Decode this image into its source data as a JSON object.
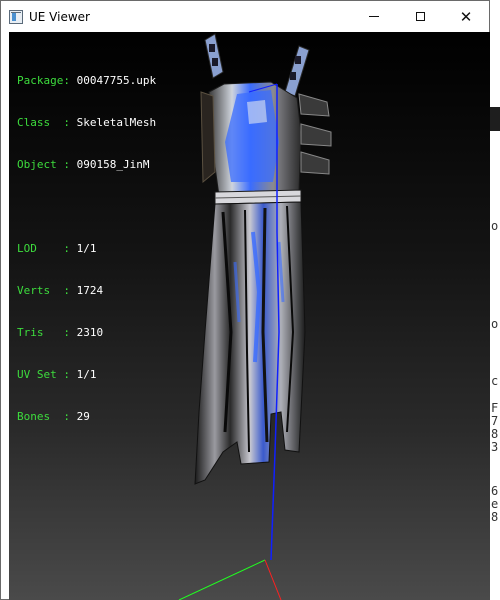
{
  "window": {
    "title": "UE Viewer",
    "buttons": {
      "minimize": "—",
      "maximize": "☐",
      "close": "✕"
    }
  },
  "info": {
    "package_label": "Package:",
    "package": "00047755.upk",
    "class_label": "Class  :",
    "class": "SkeletalMesh",
    "object_label": "Object :",
    "object": "090158_JinM",
    "lod_label": "LOD    :",
    "lod": "1/1",
    "verts_label": "Verts  :",
    "verts": "1724",
    "tris_label": "Tris   :",
    "tris": "2310",
    "uvset_label": "UV Set :",
    "uvset": "1/1",
    "bones_label": "Bones  :",
    "bones": "29"
  },
  "background_fragments": [
    "o",
    "o",
    "c",
    "F",
    "7",
    "8",
    "3",
    "6",
    "e",
    "8"
  ],
  "colors": {
    "label": "#3ddc3d",
    "value": "#ffffff",
    "bone_line": "#1020ff",
    "axis_x": "#ff2020",
    "axis_y": "#20ff20",
    "accent": "#3a6cff"
  },
  "icons": [
    "ue-viewer-app-icon",
    "minimize-icon",
    "maximize-icon",
    "close-icon"
  ]
}
